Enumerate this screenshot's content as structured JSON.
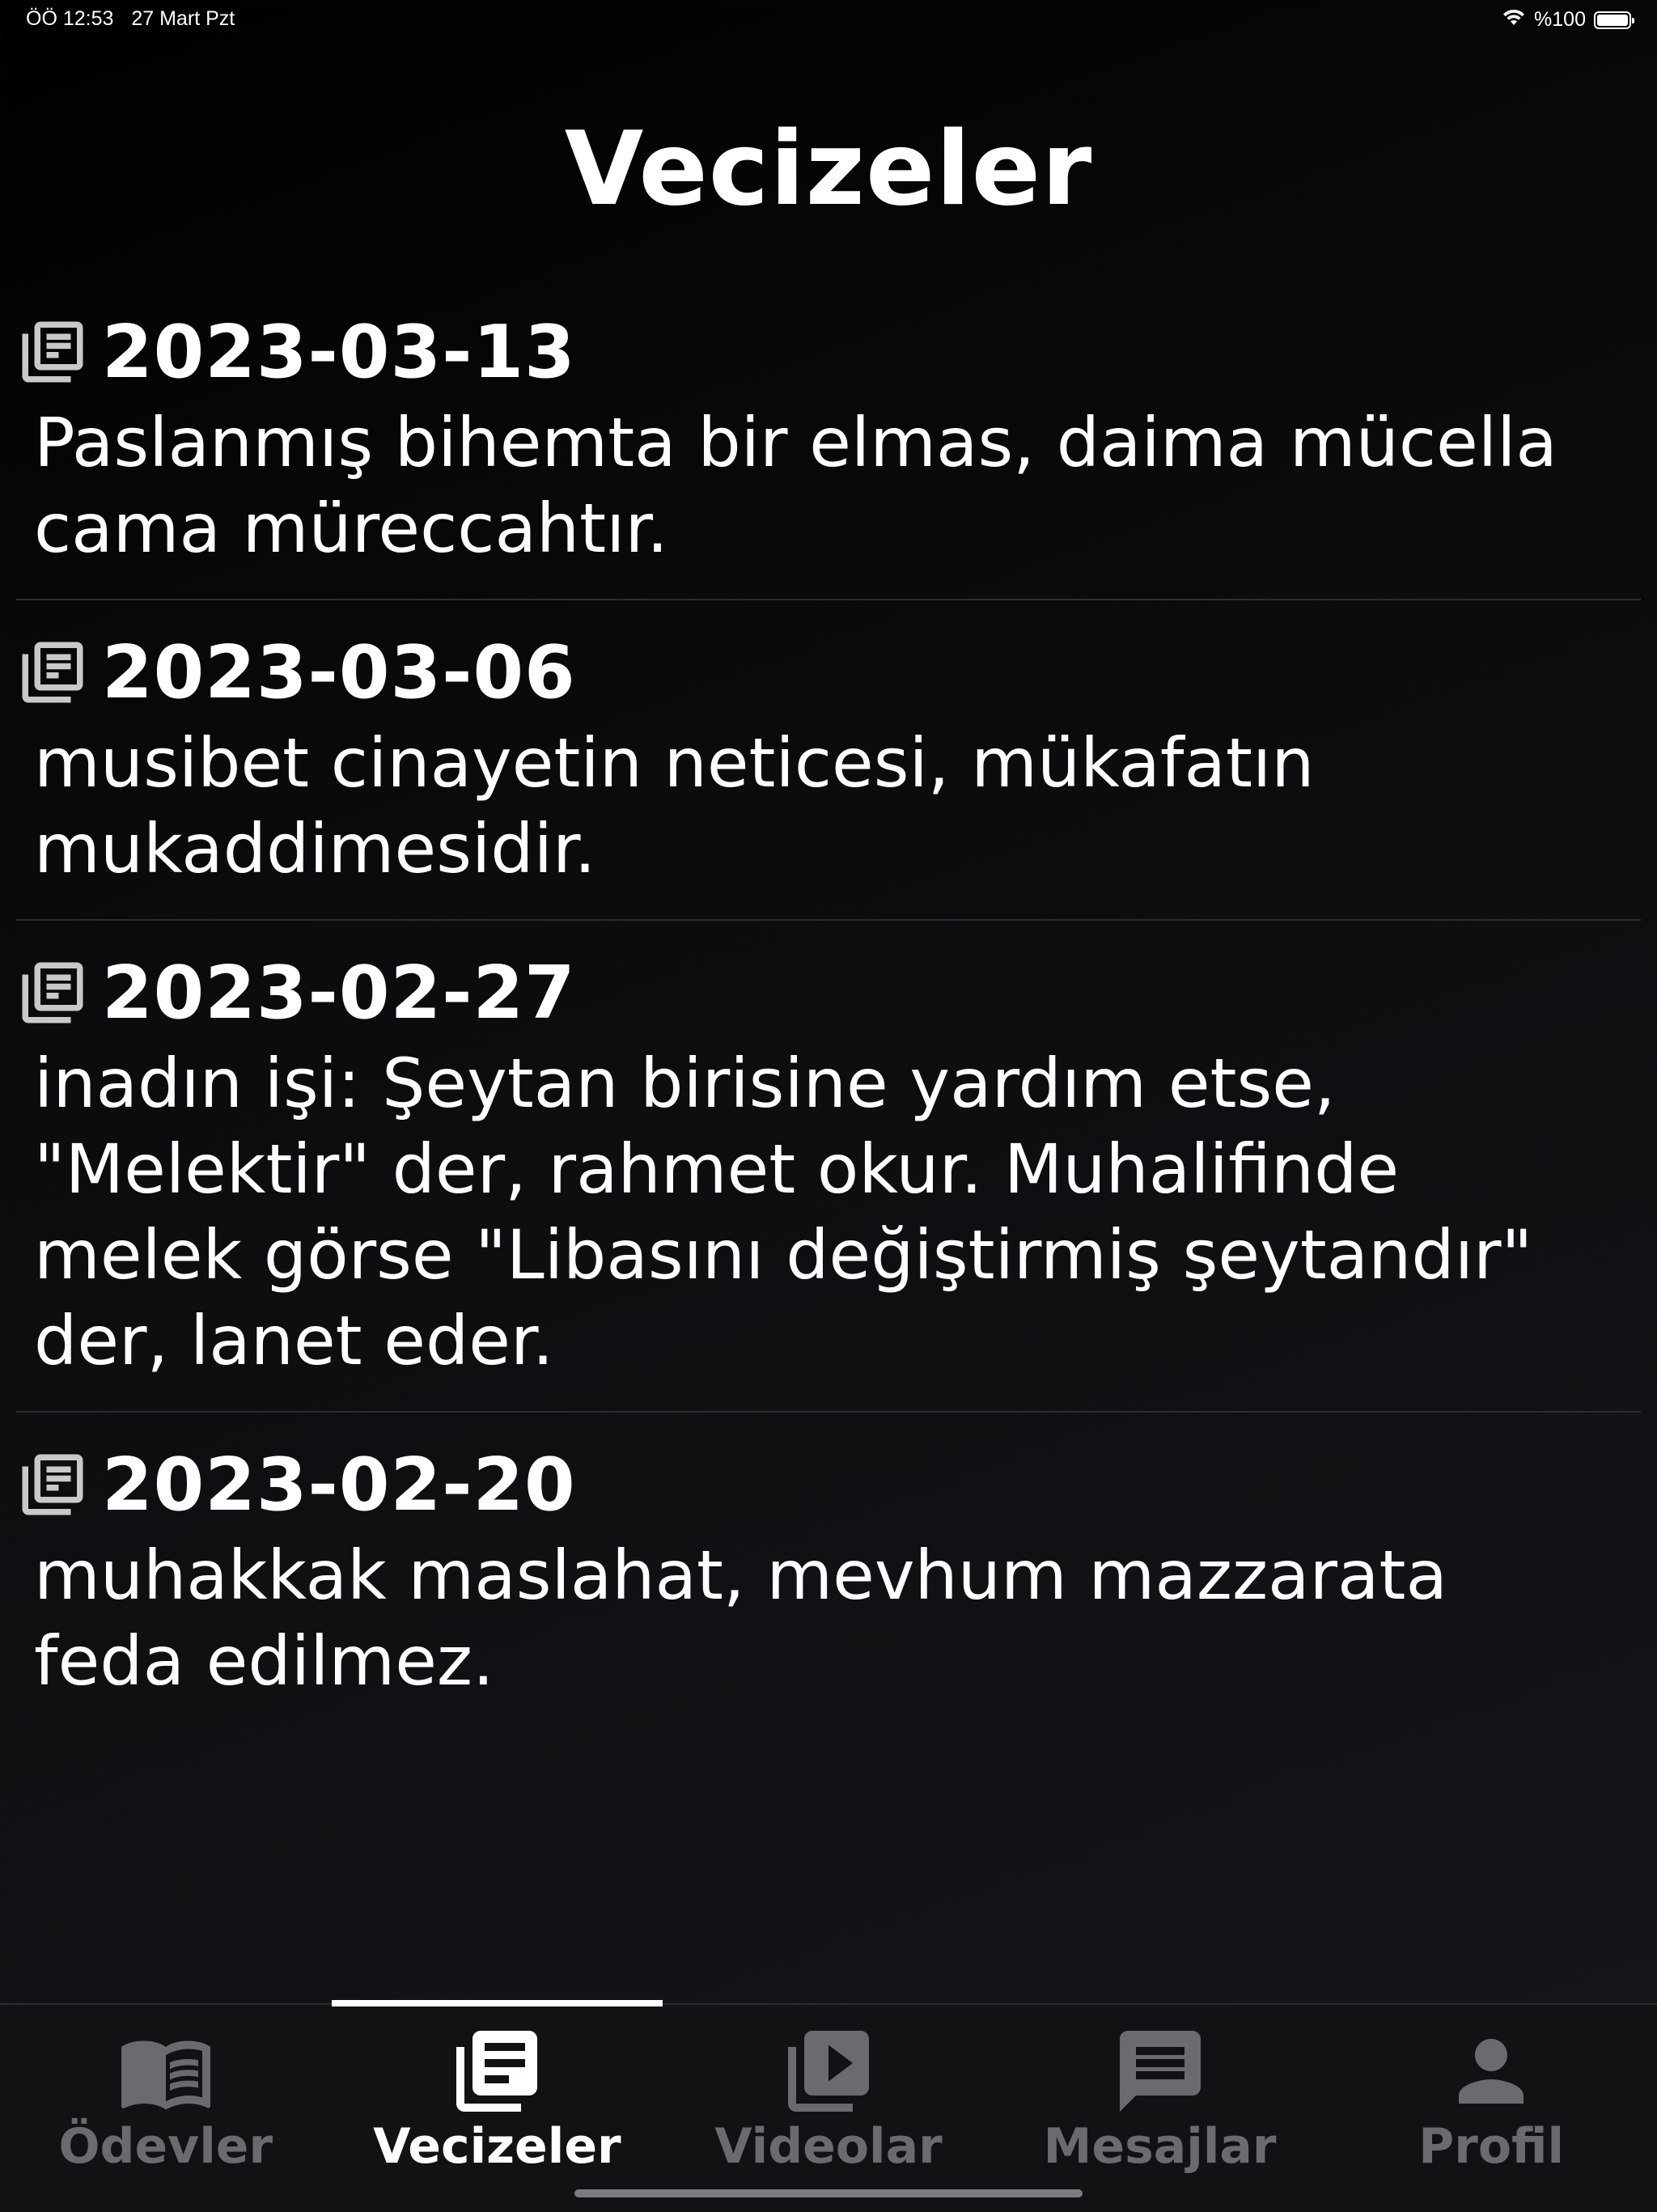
{
  "status_bar": {
    "time": "ÖÖ 12:53",
    "date": "27 Mart Pzt",
    "battery_text": "%100",
    "battery_level": 1.0
  },
  "page": {
    "title": "Vecizeler"
  },
  "quotes": [
    {
      "date": "2023-03-13",
      "text": "Paslanmış bihemta bir elmas, daima mücella cama müreccahtır."
    },
    {
      "date": "2023-03-06",
      "text": "musibet cinayetin neticesi, mükafatın mukaddimesidir."
    },
    {
      "date": "2023-02-27",
      "text": "inadın işi: Şeytan birisine yardım etse, \"Melektir\" der, rahmet okur. Muhalifinde melek görse \"Libasını değiştirmiş şeytandır\" der, lanet eder."
    },
    {
      "date": "2023-02-20",
      "text": "muhakkak maslahat, mevhum mazzarata feda edilmez."
    }
  ],
  "tabs": [
    {
      "label": "Ödevler",
      "icon": "book-icon",
      "active": false
    },
    {
      "label": "Vecizeler",
      "icon": "newspaper-icon",
      "active": true
    },
    {
      "label": "Videolar",
      "icon": "video-library-icon",
      "active": false
    },
    {
      "label": "Mesajlar",
      "icon": "message-icon",
      "active": false
    },
    {
      "label": "Profil",
      "icon": "person-icon",
      "active": false
    }
  ],
  "colors": {
    "background": "#0b0b0d",
    "tab_inactive": "#6a6b70",
    "tab_active": "#ffffff",
    "divider": "#2c2d31"
  }
}
